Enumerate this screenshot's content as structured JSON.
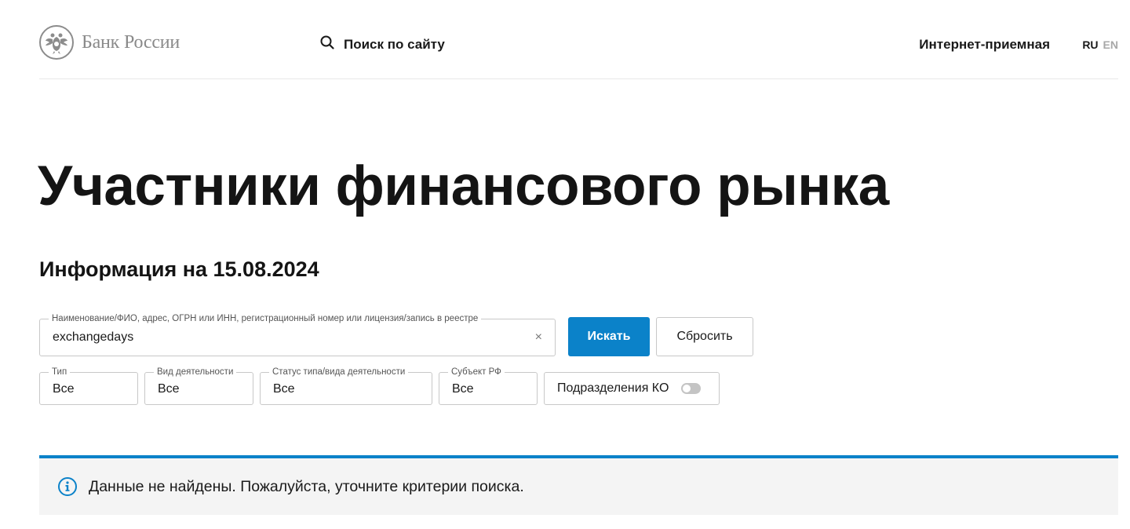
{
  "header": {
    "logo_text": "Банк России",
    "search_label": "Поиск по сайту",
    "reception_link": "Интернет-приемная",
    "lang_ru": "RU",
    "lang_en": "EN"
  },
  "page": {
    "title": "Участники финансового рынка",
    "info_date": "Информация на 15.08.2024"
  },
  "search_form": {
    "main_field_label": "Наименование/ФИО, адрес, ОГРН или ИНН, регистрационный номер или лицензия/запись в реестре",
    "main_field_value": "exchangedays",
    "clear_symbol": "×",
    "search_button": "Искать",
    "reset_button": "Сбросить"
  },
  "filters": [
    {
      "label": "Тип",
      "value": "Все"
    },
    {
      "label": "Вид деятельности",
      "value": "Все"
    },
    {
      "label": "Статус типа/вида деятельности",
      "value": "Все"
    },
    {
      "label": "Субъект РФ",
      "value": "Все"
    }
  ],
  "toggle": {
    "label": "Подразделения КО",
    "enabled": false
  },
  "notice": {
    "text": "Данные не найдены. Пожалуйста, уточните критерии поиска."
  },
  "colors": {
    "accent": "#0b82c9",
    "notice_bg": "#f4f4f4",
    "border": "#c8c8c8"
  },
  "icons": {
    "logo": "double-headed-eagle-emblem",
    "search": "search-icon",
    "clear": "close-icon",
    "notice": "info-icon"
  }
}
